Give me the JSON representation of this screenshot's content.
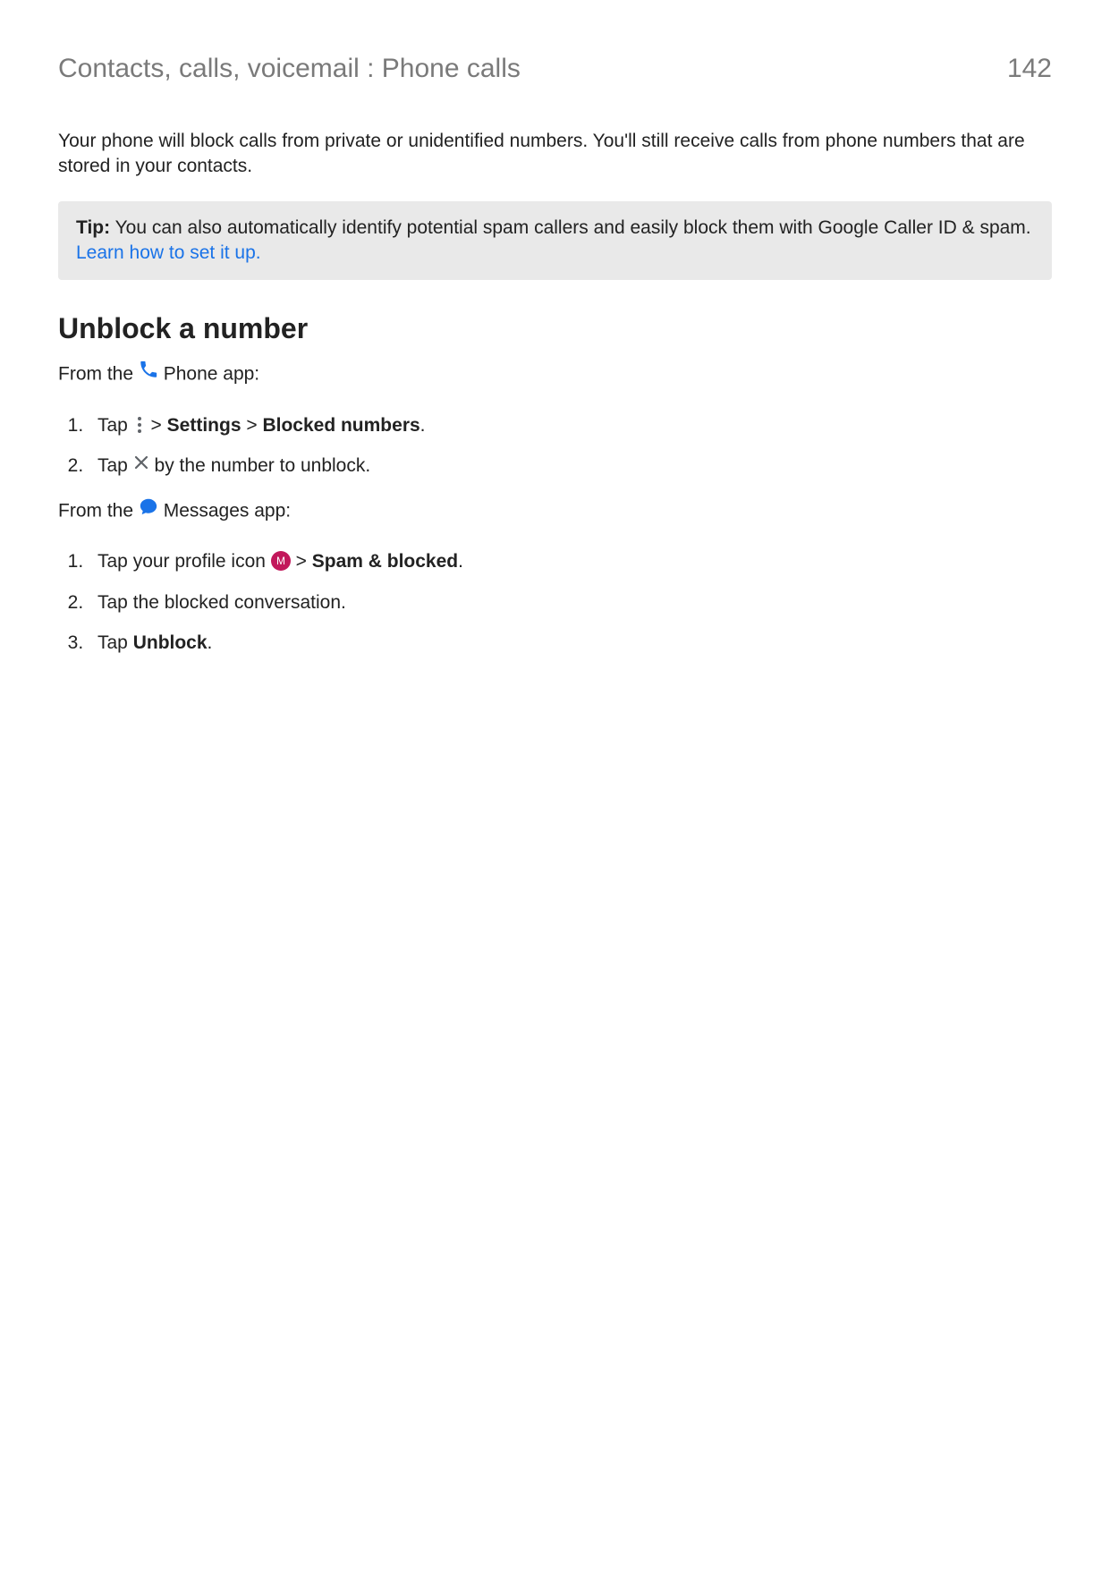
{
  "header": {
    "breadcrumb": "Contacts, calls, voicemail : Phone calls",
    "page_number": "142"
  },
  "intro": "Your phone will block calls from private or unidentified numbers. You'll still receive calls from phone numbers that are stored in your contacts.",
  "tip": {
    "label": "Tip:",
    "text": " You can also automatically identify potential spam callers and easily block them with Google Caller ID & spam. ",
    "link": "Learn how to set it up."
  },
  "section": {
    "heading": "Unblock a number",
    "phone_lead_before": "From the ",
    "phone_lead_after": " Phone app:",
    "phone_steps": {
      "s1_tap": "Tap ",
      "s1_sep1": " > ",
      "s1_settings": "Settings",
      "s1_sep2": " > ",
      "s1_blocked": "Blocked numbers",
      "s1_end": ".",
      "s2_tap": "Tap ",
      "s2_after": " by the number to unblock."
    },
    "messages_lead_before": "From the ",
    "messages_lead_after": " Messages app:",
    "messages_steps": {
      "s1_pre": "Tap your profile icon ",
      "s1_sep": " > ",
      "s1_spam": "Spam & blocked",
      "s1_end": ".",
      "s2": "Tap the blocked conversation.",
      "s3_pre": "Tap ",
      "s3_unblock": "Unblock",
      "s3_end": "."
    }
  },
  "icons": {
    "avatar_letter": "M"
  }
}
